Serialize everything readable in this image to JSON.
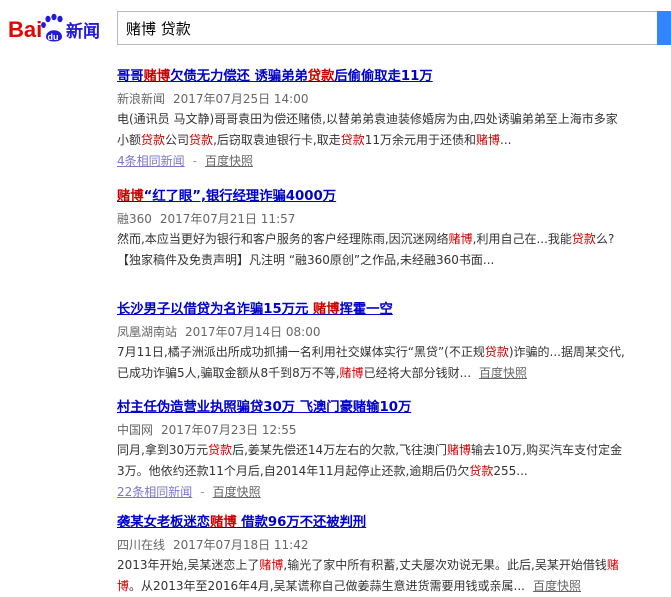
{
  "brand": {
    "logo_text_left": "Bai",
    "logo_text_paw": "du",
    "logo_text_right": "新闻"
  },
  "search": {
    "query": "赌博 贷款"
  },
  "colors": {
    "title_link": "#0000cc",
    "highlight": "#cc0000",
    "meta": "#666666",
    "search_button": "#3385ff",
    "logo_red": "#e10602",
    "logo_blue": "#2319dc"
  },
  "results": [
    {
      "title": [
        "哥哥",
        "赌博",
        "欠债无力偿还 诱骗弟弟",
        "贷款",
        "后偷偷取走11万"
      ],
      "source": "新浪新闻",
      "date": "2017年07月25日 14:00",
      "lines": [
        [
          "电(通讯员 马文静)哥哥袁田为偿还赌债,以替弟弟袁迪装修婚房为由,四处诱骗弟弟至上海市多家"
        ],
        [
          "小额",
          "贷款",
          "公司",
          "贷款",
          ",后窃取袁迪银行卡,取走",
          "贷款",
          "11万余元用于还债和",
          "赌博",
          "..."
        ]
      ],
      "links": {
        "related": "4条相同新闻",
        "snapshot": "百度快照"
      }
    },
    {
      "title": [
        "赌博",
        "“红了眼”,银行经理诈骗4000万"
      ],
      "source": "融360",
      "date": "2017年07月21日 11:57",
      "lines": [
        [
          "然而,本应当更好为银行和客户服务的客户经理陈雨,因沉迷网络",
          "赌博",
          ",利用自己在...我能",
          "贷款",
          "么?"
        ],
        [
          "【独家稿件及免责声明】凡注明 “融360原创”之作品,未经融360书面..."
        ]
      ],
      "links": {}
    },
    {
      "title": [
        "长沙男子以借贷为名诈骗15万元 ",
        "赌博",
        "挥霍一空"
      ],
      "source": "凤凰湖南站",
      "date": "2017年07月14日 08:00",
      "lines": [
        [
          "7月11日,橘子洲派出所成功抓捕一名利用社交媒体实行“黑贷”(不正规",
          "贷款",
          ")诈骗的...据周某交代,"
        ],
        [
          "已成功诈骗5人,骗取金额从8千到8万不等,",
          "赌博",
          "已经将大部分钱财..."
        ]
      ],
      "links": {
        "snapshot_inline": "百度快照"
      }
    },
    {
      "title": [
        "村主任伪造营业执照骗贷30万 飞澳门豪赌输10万"
      ],
      "source": "中国网",
      "date": "2017年07月23日 12:55",
      "lines": [
        [
          "同月,拿到30万元",
          "贷款",
          "后,姜某先偿还14万左右的欠款,飞往澳门",
          "赌博",
          "输去10万,购买汽车支付定金"
        ],
        [
          "3万。他依约还款11个月后,自2014年11月起停止还款,逾期后仍欠",
          "贷款",
          "255..."
        ]
      ],
      "links": {
        "related": "22条相同新闻",
        "snapshot": "百度快照"
      }
    },
    {
      "title": [
        "袭某女老板迷恋",
        "赌博",
        " 借款96万不还被判刑"
      ],
      "source": "四川在线",
      "date": "2017年07月18日 11:42",
      "lines": [
        [
          "2013年开始,吴某迷恋上了",
          "赌博",
          ",输光了家中所有积蓄,丈夫屡次劝说无果。此后,吴某开始借钱",
          "赌"
        ],
        [
          "博",
          "。从2013年至2016年4月,吴某谎称自己做姜蒜生意进货需要用钱或亲属..."
        ]
      ],
      "links": {
        "snapshot_inline": "百度快照"
      }
    }
  ]
}
